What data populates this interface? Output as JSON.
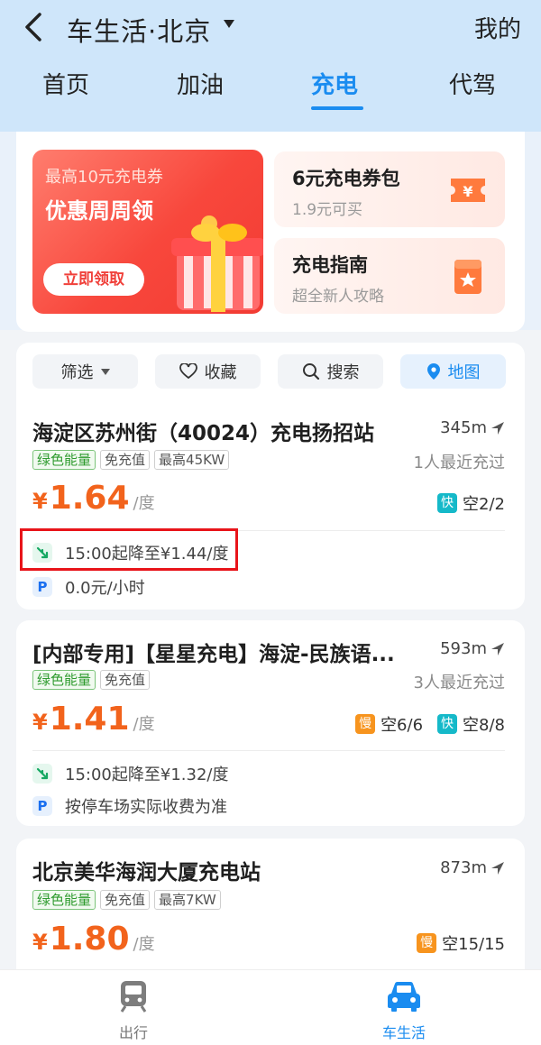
{
  "header": {
    "title": "车生活·北京",
    "mine": "我的",
    "tabs": [
      "首页",
      "加油",
      "充电",
      "代驾"
    ],
    "active_tab": "充电"
  },
  "promo": {
    "banner_sub": "最高10元充电券",
    "banner_title": "优惠周周领",
    "banner_button": "立即领取",
    "cards": [
      {
        "title": "6元充电券包",
        "sub": "1.9元可买",
        "icon": "coupon-icon"
      },
      {
        "title": "充电指南",
        "sub": "超全新人攻略",
        "icon": "guide-book-icon"
      }
    ]
  },
  "filters": [
    "筛选",
    "收藏",
    "搜索",
    "地图"
  ],
  "stations": [
    {
      "name": "海淀区苏州街（40024）充电扬招站",
      "distance": "345m",
      "tags": [
        "绿色能量",
        "免充值",
        "最高45KW"
      ],
      "recent": "1人最近充过",
      "price": "1.64",
      "currency": "¥",
      "unit": "/度",
      "slots": [
        {
          "type": "快",
          "text": "空2/2"
        }
      ],
      "discount": "15:00起降至¥1.44/度",
      "parking": "0.0元/小时"
    },
    {
      "name": "[内部专用]【星星充电】海淀-民族语...",
      "distance": "593m",
      "tags": [
        "绿色能量",
        "免充值"
      ],
      "recent": "3人最近充过",
      "price": "1.41",
      "currency": "¥",
      "unit": "/度",
      "slots": [
        {
          "type": "慢",
          "text": "空6/6"
        },
        {
          "type": "快",
          "text": "空8/8"
        }
      ],
      "discount": "15:00起降至¥1.32/度",
      "parking": "按停车场实际收费为准"
    },
    {
      "name": "北京美华海润大厦充电站",
      "distance": "873m",
      "tags": [
        "绿色能量",
        "免充值",
        "最高7KW"
      ],
      "recent": "",
      "price": "1.80",
      "currency": "¥",
      "unit": "/度",
      "slots": [
        {
          "type": "慢",
          "text": "空15/15"
        }
      ]
    }
  ],
  "bottom_nav": [
    {
      "label": "出行",
      "icon": "train-icon"
    },
    {
      "label": "车生活",
      "icon": "car-icon"
    }
  ],
  "colors": {
    "accent": "#1a8cf0",
    "price": "#f2631c",
    "highlight": "#e8141a"
  }
}
